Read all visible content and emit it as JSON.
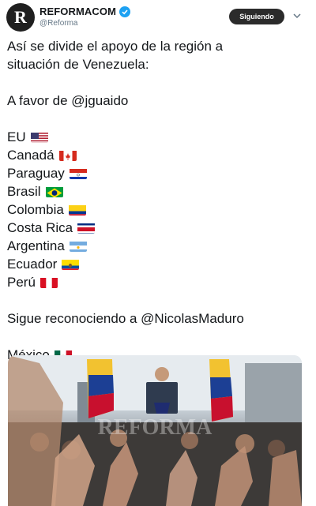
{
  "account": {
    "name": "REFORMACOM",
    "handle": "@Reforma",
    "avatar_letter": "R",
    "verified": true
  },
  "follow_button": {
    "label": "Siguiendo"
  },
  "tweet": {
    "intro_line1": "Así se divide el apoyo de la región a",
    "intro_line2": "situación de Venezuela:",
    "favor_heading": "A favor de @jguaido",
    "favor_countries": [
      {
        "name": "EU",
        "flag": "us-flag-icon"
      },
      {
        "name": "Canadá",
        "flag": "canada-flag-icon"
      },
      {
        "name": "Paraguay",
        "flag": "paraguay-flag-icon"
      },
      {
        "name": "Brasil",
        "flag": "brazil-flag-icon"
      },
      {
        "name": "Colombia",
        "flag": "colombia-flag-icon"
      },
      {
        "name": "Costa Rica",
        "flag": "costa-rica-flag-icon"
      },
      {
        "name": "Argentina",
        "flag": "argentina-flag-icon"
      },
      {
        "name": "Ecuador",
        "flag": "ecuador-flag-icon"
      },
      {
        "name": "Perú",
        "flag": "peru-flag-icon"
      }
    ],
    "maduro_heading": "Sigue reconociendo a @NicolasMaduro",
    "maduro_countries": [
      {
        "name": "México",
        "flag": "mexico-flag-icon"
      }
    ]
  },
  "media": {
    "watermark": "REFORMA"
  },
  "colors": {
    "verified": "#1da1f2",
    "button_bg": "#2b2b2b",
    "handle": "#657786"
  }
}
